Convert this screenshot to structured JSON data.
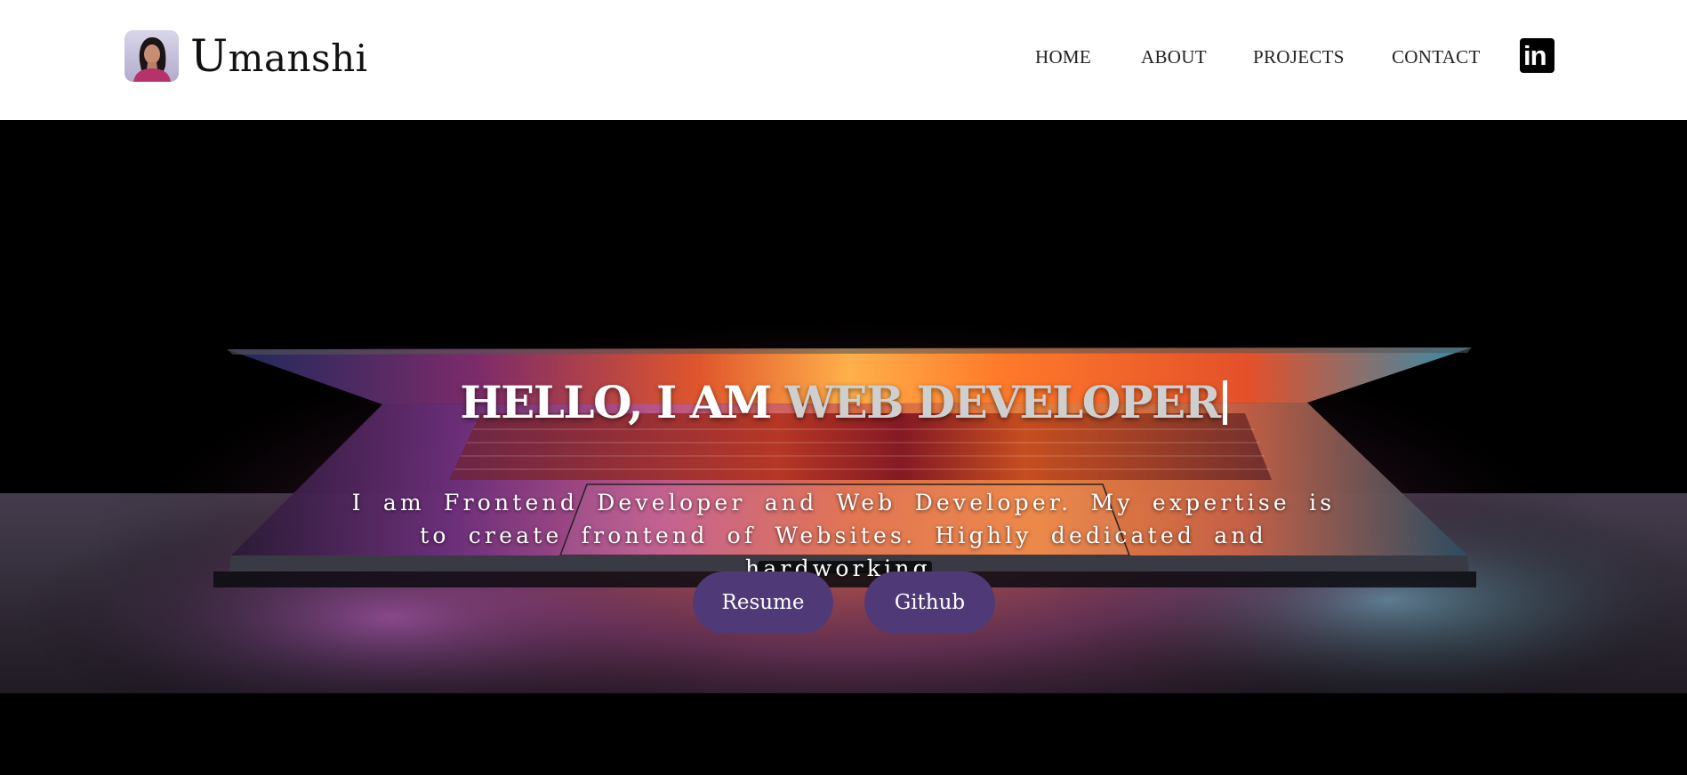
{
  "brand": {
    "name": "Umanshi",
    "avatar_icon": "profile-photo"
  },
  "nav": {
    "items": [
      "HOME",
      "ABOUT",
      "PROJECTS",
      "CONTACT"
    ],
    "linkedin_icon": "linkedin-icon",
    "linkedin_glyph": "in"
  },
  "hero": {
    "headline_static": "HELLO, I AM",
    "headline_typed": "WEB DEVELOPER",
    "intro": "I am Frontend Developer and Web Developer. My expertise is to create frontend of Websites. Highly dedicated and hardworking.",
    "buttons": {
      "resume": "Resume",
      "github": "Github"
    },
    "background": "laptop-photo"
  },
  "colors": {
    "header_bg": "#ffffff",
    "hero_bg": "#000000",
    "button_bg": "#4f3a77",
    "button_text": "#ffffff",
    "typed_text": "#cfcfcf"
  }
}
